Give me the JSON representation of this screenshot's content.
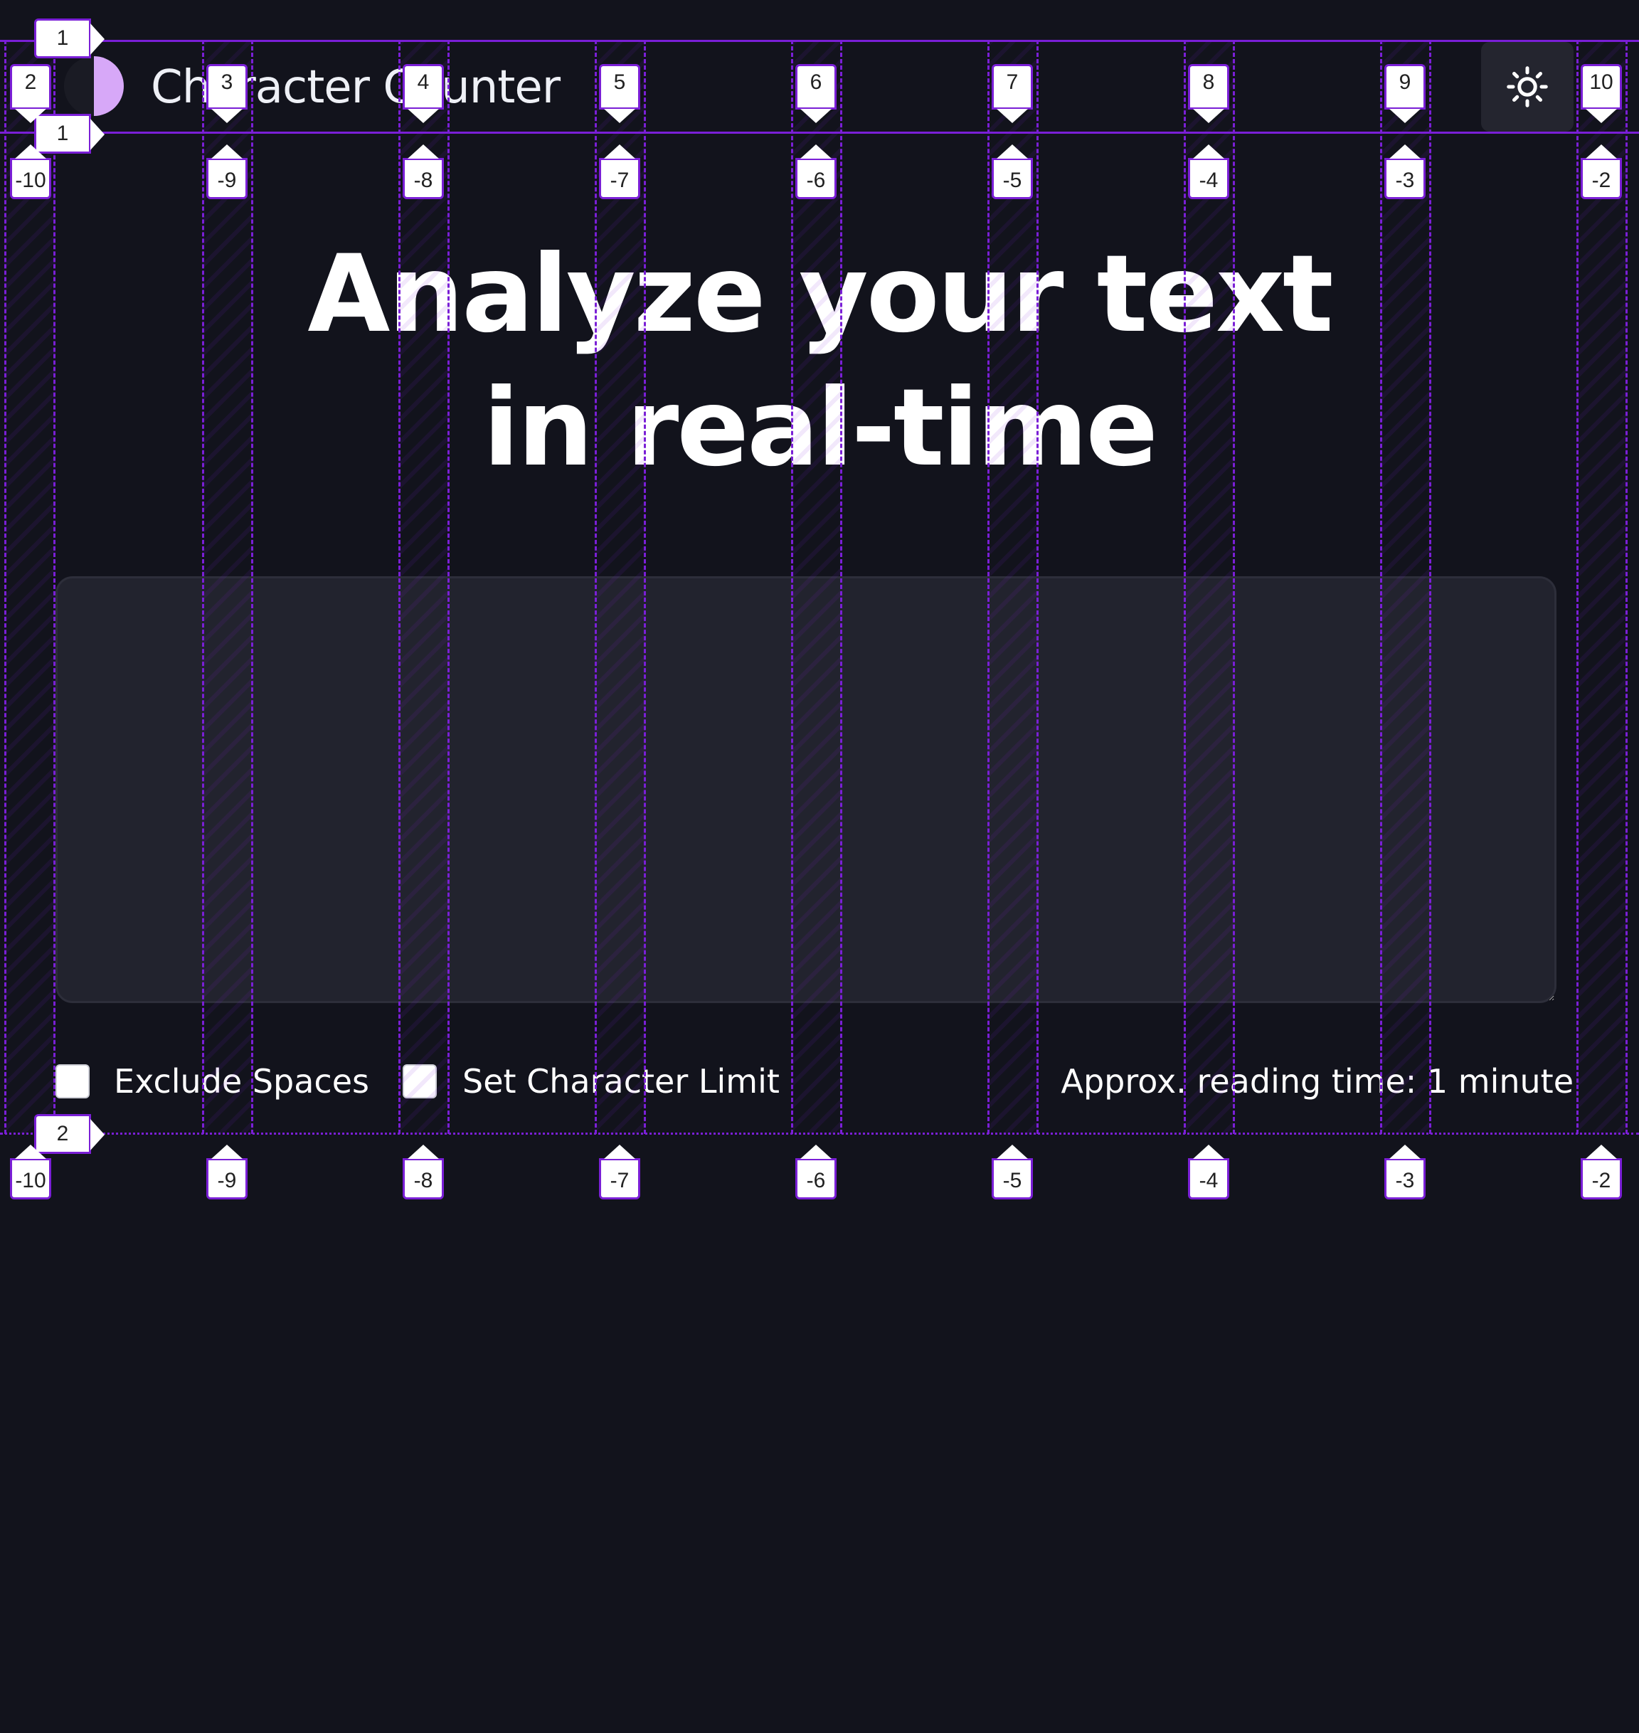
{
  "header": {
    "app_title": "Character Counter",
    "logo_icon": "half-moon-logo-icon",
    "theme_toggle_icon": "sun-icon"
  },
  "hero": {
    "line1": "Analyze your text",
    "line2": "in real-time"
  },
  "editor": {
    "value": "",
    "placeholder": ""
  },
  "options": {
    "exclude_spaces_label": "Exclude Spaces",
    "exclude_spaces_checked": false,
    "char_limit_label": "Set Character Limit",
    "char_limit_checked": false,
    "reading_time": "Approx. reading time: 1 minute"
  },
  "guide_overlay": {
    "column_labels_top": [
      "2",
      "3",
      "4",
      "5",
      "6",
      "7",
      "8",
      "9",
      "10"
    ],
    "column_labels_bottom": [
      "-10",
      "-9",
      "-8",
      "-7",
      "-6",
      "-5",
      "-4",
      "-3",
      "-2"
    ],
    "row_labels": [
      "1",
      "1",
      "2"
    ],
    "color": "#7a1fd6"
  },
  "colors": {
    "background": "#12131c",
    "surface": "#22232e",
    "accent": "#d7a8f8",
    "text": "#ffffff"
  }
}
